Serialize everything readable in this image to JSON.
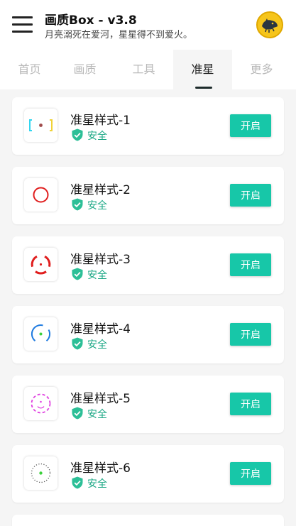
{
  "header": {
    "title": "画质Box - v3.8",
    "subtitle": "月亮溺死在爱河，星星得不到爱火。"
  },
  "tabs": [
    {
      "label": "首页",
      "active": false
    },
    {
      "label": "画质",
      "active": false
    },
    {
      "label": "工具",
      "active": false
    },
    {
      "label": "准星",
      "active": true
    },
    {
      "label": "更多",
      "active": false
    }
  ],
  "items": [
    {
      "title": "准星样式-1",
      "status": "安全",
      "button": "开启",
      "icon": "crosshair-style-1-icon"
    },
    {
      "title": "准星样式-2",
      "status": "安全",
      "button": "开启",
      "icon": "crosshair-style-2-icon"
    },
    {
      "title": "准星样式-3",
      "status": "安全",
      "button": "开启",
      "icon": "crosshair-style-3-icon"
    },
    {
      "title": "准星样式-4",
      "status": "安全",
      "button": "开启",
      "icon": "crosshair-style-4-icon"
    },
    {
      "title": "准星样式-5",
      "status": "安全",
      "button": "开启",
      "icon": "crosshair-style-5-icon"
    },
    {
      "title": "准星样式-6",
      "status": "安全",
      "button": "开启",
      "icon": "crosshair-style-6-icon"
    }
  ],
  "colors": {
    "accent": "#17c7a8",
    "safe_text": "#1aa784",
    "background": "#f5f5f5"
  }
}
